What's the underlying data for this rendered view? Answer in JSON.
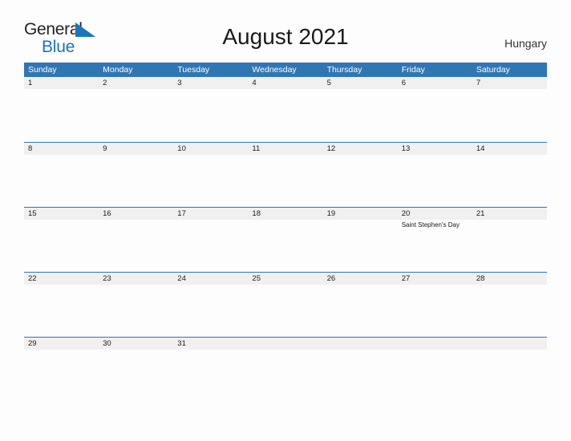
{
  "brand": {
    "name_part1": "General",
    "name_part2": "Blue",
    "triangle_color": "#1b75bb"
  },
  "header": {
    "title": "August 2021",
    "country": "Hungary"
  },
  "theme": {
    "accent_blue": "#2f76b4",
    "daynum_bg": "#f0f0f0",
    "text_dark": "#1a1a1a",
    "page_bg": "#fdfdfd"
  },
  "calendar": {
    "weekdays": [
      "Sunday",
      "Monday",
      "Tuesday",
      "Wednesday",
      "Thursday",
      "Friday",
      "Saturday"
    ],
    "weeks": [
      {
        "days": [
          {
            "num": "1",
            "events": []
          },
          {
            "num": "2",
            "events": []
          },
          {
            "num": "3",
            "events": []
          },
          {
            "num": "4",
            "events": []
          },
          {
            "num": "5",
            "events": []
          },
          {
            "num": "6",
            "events": []
          },
          {
            "num": "7",
            "events": []
          }
        ]
      },
      {
        "days": [
          {
            "num": "8",
            "events": []
          },
          {
            "num": "9",
            "events": []
          },
          {
            "num": "10",
            "events": []
          },
          {
            "num": "11",
            "events": []
          },
          {
            "num": "12",
            "events": []
          },
          {
            "num": "13",
            "events": []
          },
          {
            "num": "14",
            "events": []
          }
        ]
      },
      {
        "days": [
          {
            "num": "15",
            "events": []
          },
          {
            "num": "16",
            "events": []
          },
          {
            "num": "17",
            "events": []
          },
          {
            "num": "18",
            "events": []
          },
          {
            "num": "19",
            "events": []
          },
          {
            "num": "20",
            "events": [
              "Saint Stephen's Day"
            ]
          },
          {
            "num": "21",
            "events": []
          }
        ]
      },
      {
        "days": [
          {
            "num": "22",
            "events": []
          },
          {
            "num": "23",
            "events": []
          },
          {
            "num": "24",
            "events": []
          },
          {
            "num": "25",
            "events": []
          },
          {
            "num": "26",
            "events": []
          },
          {
            "num": "27",
            "events": []
          },
          {
            "num": "28",
            "events": []
          }
        ]
      },
      {
        "days": [
          {
            "num": "29",
            "events": []
          },
          {
            "num": "30",
            "events": []
          },
          {
            "num": "31",
            "events": []
          },
          {
            "num": "",
            "events": []
          },
          {
            "num": "",
            "events": []
          },
          {
            "num": "",
            "events": []
          },
          {
            "num": "",
            "events": []
          }
        ]
      }
    ]
  }
}
